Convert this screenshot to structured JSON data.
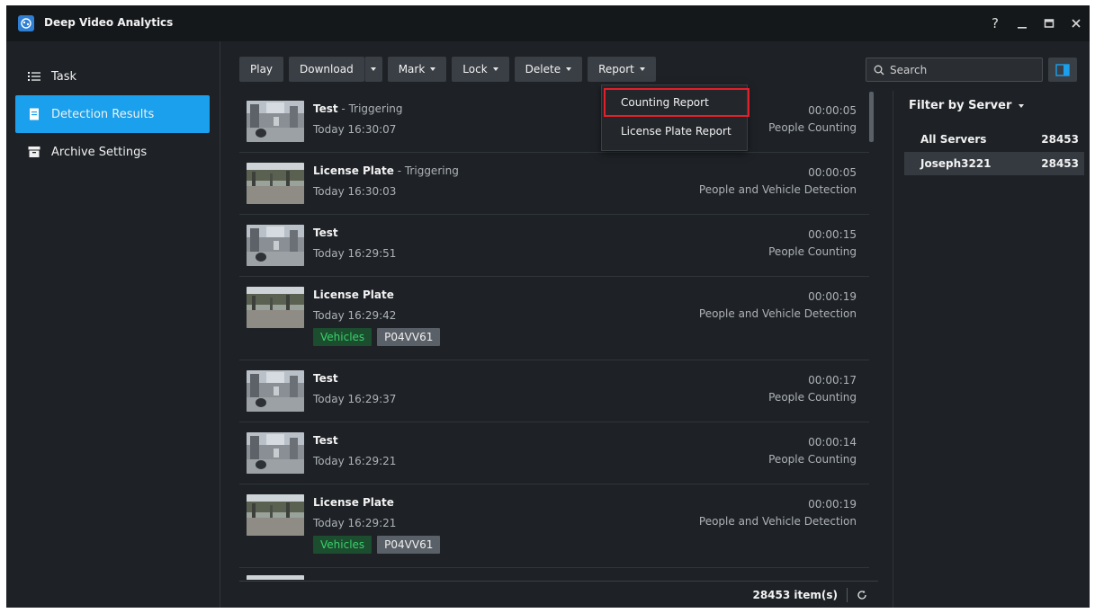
{
  "app": {
    "title": "Deep Video Analytics"
  },
  "window_controls": {
    "help": "?",
    "minimize": "—",
    "maximize": "▭",
    "close": "✕"
  },
  "sidebar": {
    "items": [
      {
        "label": "Task",
        "icon": "list-icon"
      },
      {
        "label": "Detection Results",
        "icon": "document-icon",
        "active": true
      },
      {
        "label": "Archive Settings",
        "icon": "archive-icon"
      }
    ]
  },
  "toolbar": {
    "play": "Play",
    "download": "Download",
    "mark": "Mark",
    "lock": "Lock",
    "delete": "Delete",
    "report": "Report"
  },
  "search": {
    "placeholder": "Search"
  },
  "report_menu": {
    "items": [
      "Counting Report",
      "License Plate Report"
    ],
    "highlighted": "Counting Report"
  },
  "results": [
    {
      "title": "Test",
      "subtitle": " - Triggering",
      "time": "Today 16:30:07",
      "duration": "00:00:05",
      "type": "People Counting",
      "thumb": "indoor",
      "tags": []
    },
    {
      "title": "License Plate",
      "subtitle": " - Triggering",
      "time": "Today 16:30:03",
      "duration": "00:00:05",
      "type": "People and Vehicle Detection",
      "thumb": "outdoor",
      "tags": []
    },
    {
      "title": "Test",
      "subtitle": "",
      "time": "Today 16:29:51",
      "duration": "00:00:15",
      "type": "People Counting",
      "thumb": "indoor",
      "tags": []
    },
    {
      "title": "License Plate",
      "subtitle": "",
      "time": "Today 16:29:42",
      "duration": "00:00:19",
      "type": "People and Vehicle Detection",
      "thumb": "outdoor",
      "tags": [
        "Vehicles",
        "P04VV61"
      ]
    },
    {
      "title": "Test",
      "subtitle": "",
      "time": "Today 16:29:37",
      "duration": "00:00:17",
      "type": "People Counting",
      "thumb": "indoor",
      "tags": []
    },
    {
      "title": "Test",
      "subtitle": "",
      "time": "Today 16:29:21",
      "duration": "00:00:14",
      "type": "People Counting",
      "thumb": "indoor",
      "tags": []
    },
    {
      "title": "License Plate",
      "subtitle": "",
      "time": "Today 16:29:21",
      "duration": "00:00:19",
      "type": "People and Vehicle Detection",
      "thumb": "outdoor",
      "tags": [
        "Vehicles",
        "P04VV61"
      ]
    }
  ],
  "footer": {
    "count": "28453 item(s)"
  },
  "filter": {
    "heading": "Filter by Server",
    "servers": [
      {
        "name": "All Servers",
        "count": "28453",
        "selected": false
      },
      {
        "name": "Joseph3221",
        "count": "28453",
        "selected": true
      }
    ]
  },
  "colors": {
    "accent": "#1aa0ec",
    "highlight_border": "#e0202a",
    "tag_green": "#3ad06a"
  }
}
